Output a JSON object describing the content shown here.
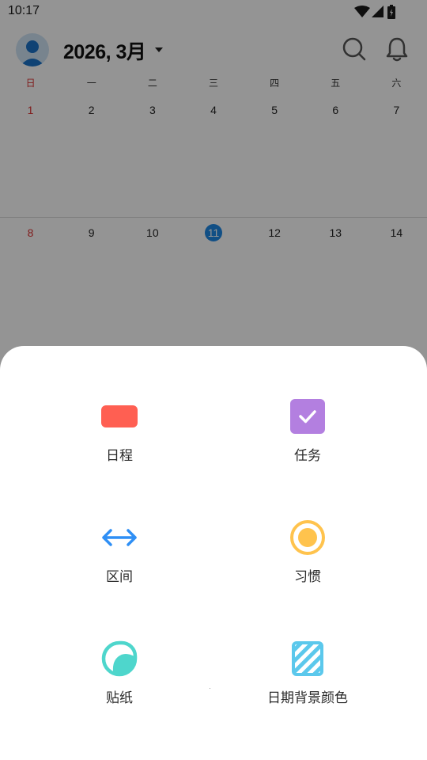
{
  "status_bar": {
    "time": "10:17"
  },
  "header": {
    "month_label": "2026, 3月"
  },
  "calendar": {
    "weekdays": [
      "日",
      "一",
      "二",
      "三",
      "四",
      "五",
      "六"
    ],
    "week1": [
      "1",
      "2",
      "3",
      "4",
      "5",
      "6",
      "7"
    ],
    "week2": [
      "8",
      "9",
      "10",
      "11",
      "12",
      "13",
      "14"
    ],
    "today": "11",
    "colors": {
      "sunday": "#d33333",
      "today": "#1e88e5"
    }
  },
  "sheet": {
    "options": [
      {
        "label": "日程",
        "icon": "schedule-icon",
        "color": "#ff5f52"
      },
      {
        "label": "任务",
        "icon": "task-check-icon",
        "color": "#b37fe0"
      },
      {
        "label": "区间",
        "icon": "range-arrow-icon",
        "color": "#2f8ff5"
      },
      {
        "label": "习惯",
        "icon": "habit-target-icon",
        "color": "#ffc34d"
      },
      {
        "label": "贴纸",
        "icon": "sticker-icon",
        "color": "#4ed6cc"
      },
      {
        "label": "日期背景颜色",
        "icon": "date-background-color-icon",
        "color": "#5bc8ec"
      }
    ]
  }
}
